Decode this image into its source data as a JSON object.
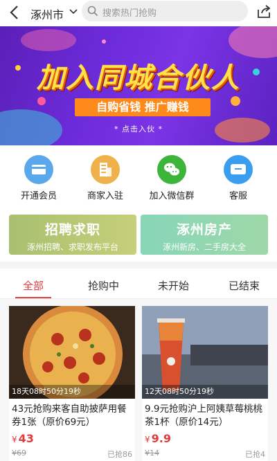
{
  "header": {
    "city": "涿州市",
    "search_placeholder": "搜索热门抢购"
  },
  "banner": {
    "title": "加入同城合伙人",
    "subtitle": "自购省钱  推广赚钱",
    "cta": "* 点击入伙 *"
  },
  "menu": {
    "items": [
      {
        "label": "开通会员",
        "icon": "membership-card-icon",
        "color": "#5aa8ec"
      },
      {
        "label": "商家入驻",
        "icon": "merchant-building-icon",
        "color": "#efb24a"
      },
      {
        "label": "加入微信群",
        "icon": "wechat-icon",
        "color": "#3db53a"
      },
      {
        "label": "客服",
        "icon": "customer-service-icon",
        "color": "#3a9ef0"
      }
    ]
  },
  "promos": [
    {
      "title": "招聘求职",
      "subtitle": "涿州招聘、求职发布平台"
    },
    {
      "title": "涿州房产",
      "subtitle": "涿州新房、二手房大全"
    }
  ],
  "tabs": [
    "全部",
    "抢购中",
    "未开始",
    "已结束"
  ],
  "products": [
    {
      "timer": "18天08时50分19秒",
      "title": "43元抢购来客自助披萨用餐券1张（原价69元）",
      "price": "43",
      "original": "¥69",
      "sold": "已抢86",
      "currency": "¥"
    },
    {
      "timer": "12天08时50分19秒",
      "title": "9.9元抢购沪上阿姨草莓桃桃茶1杯（原价14元）",
      "price": "9.9",
      "original": "¥14",
      "sold": "已抢4",
      "currency": "¥"
    }
  ],
  "colors": {
    "accent": "#e23b3b",
    "banner_purple": "#6c2bd9",
    "banner_title": "#ffe14a"
  }
}
